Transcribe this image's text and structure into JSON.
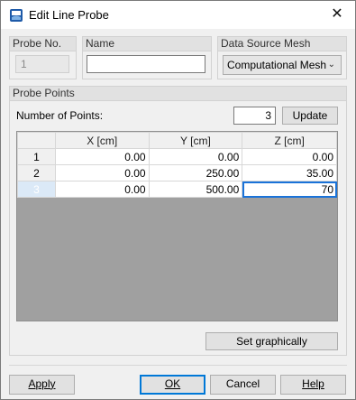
{
  "window": {
    "title": "Edit Line Probe",
    "close_glyph": "✕"
  },
  "probe_no": {
    "label": "Probe No.",
    "value": "1"
  },
  "name": {
    "label": "Name",
    "value": ""
  },
  "data_source": {
    "label": "Data Source Mesh",
    "value": "Computational Mesh"
  },
  "probe_points": {
    "label": "Probe Points",
    "num_points_label": "Number of Points:",
    "num_points_value": "3",
    "update_label": "Update",
    "columns": [
      "X [cm]",
      "Y [cm]",
      "Z [cm]"
    ],
    "rows": [
      {
        "index": "1",
        "x": "0.00",
        "y": "0.00",
        "z": "0.00"
      },
      {
        "index": "2",
        "x": "0.00",
        "y": "250.00",
        "z": "35.00"
      },
      {
        "index": "3",
        "x": "0.00",
        "y": "500.00",
        "z": "70"
      }
    ],
    "set_graphically_label": "Set graphically"
  },
  "buttons": {
    "apply": "Apply",
    "ok": "OK",
    "cancel": "Cancel",
    "help": "Help"
  },
  "colors": {
    "accent": "#0078d7",
    "selection": "#1a73d9",
    "grid_empty": "#a0a0a0"
  }
}
